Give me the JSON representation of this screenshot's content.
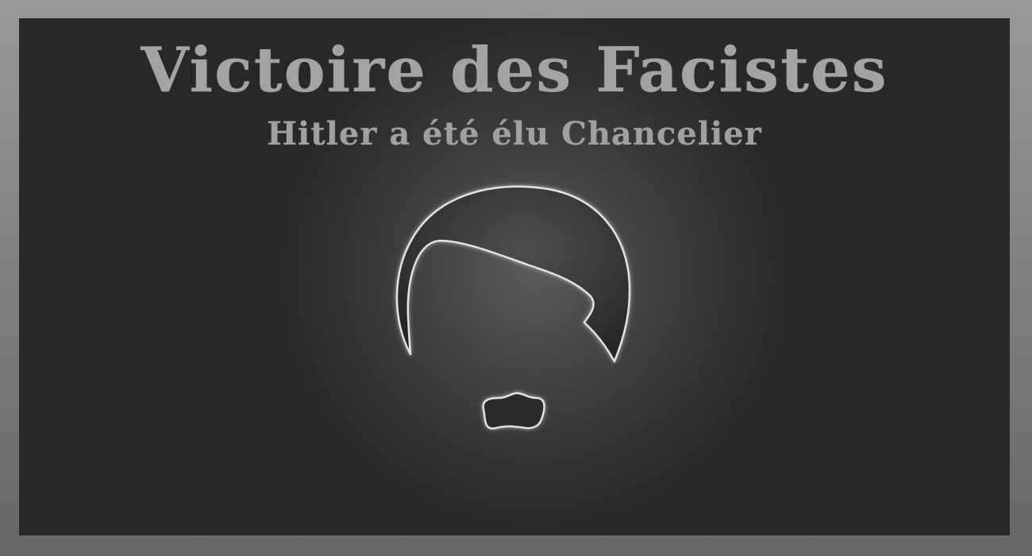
{
  "header": {
    "title": "Victoire des Facistes",
    "subtitle": "Hitler a été élu Chancelier"
  },
  "illustration": {
    "hair_icon": "hair-silhouette-icon",
    "moustache_icon": "moustache-icon"
  },
  "colors": {
    "outer_border": "#8a8a8a",
    "panel_background": "#282828",
    "glow_center": "#5b5b5b",
    "text": "#a3a3a3",
    "outline_glow": "#e8e8e8"
  }
}
